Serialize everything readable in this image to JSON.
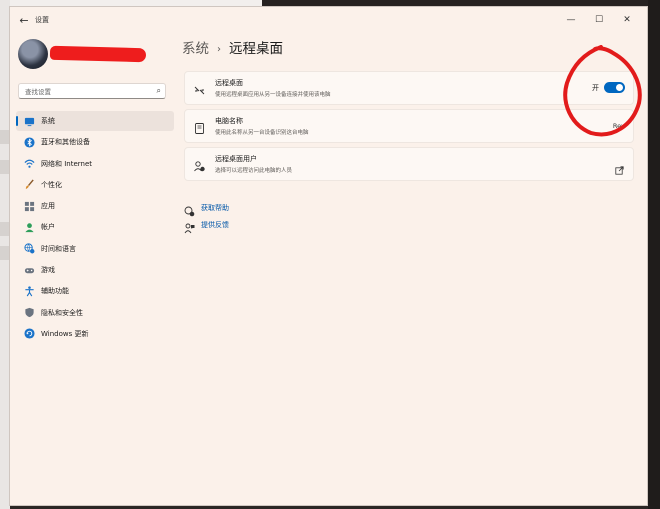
{
  "window": {
    "title": "设置",
    "controls": {
      "minimize": "—",
      "maximize": "☐",
      "close": "✕"
    }
  },
  "sidebar": {
    "search_placeholder": "查找设置",
    "items": [
      {
        "label": "系统",
        "icon": "monitor-icon",
        "selected": true
      },
      {
        "label": "蓝牙和其他设备",
        "icon": "bluetooth-icon",
        "selected": false
      },
      {
        "label": "网络和 Internet",
        "icon": "wifi-icon",
        "selected": false
      },
      {
        "label": "个性化",
        "icon": "paintbrush-icon",
        "selected": false
      },
      {
        "label": "应用",
        "icon": "apps-icon",
        "selected": false
      },
      {
        "label": "帐户",
        "icon": "account-icon",
        "selected": false
      },
      {
        "label": "时间和语言",
        "icon": "globe-clock-icon",
        "selected": false
      },
      {
        "label": "游戏",
        "icon": "gamepad-icon",
        "selected": false
      },
      {
        "label": "辅助功能",
        "icon": "accessibility-icon",
        "selected": false
      },
      {
        "label": "隐私和安全性",
        "icon": "shield-icon",
        "selected": false
      },
      {
        "label": "Windows 更新",
        "icon": "update-icon",
        "selected": false
      }
    ]
  },
  "header": {
    "parent": "系统",
    "separator": "›",
    "current": "远程桌面"
  },
  "cards": {
    "remote_desktop": {
      "title": "远程桌面",
      "subtitle": "使用远程桌面应用从另一设备连接并使用该电脑",
      "toggle_label": "开",
      "toggle_on": true
    },
    "pc_name": {
      "title": "电脑名称",
      "subtitle": "使用此名称从另一台设备识别这台电脑",
      "value": "Rey"
    },
    "users": {
      "title": "远程桌面用户",
      "subtitle": "选择可以远程访问此电脑的人员"
    }
  },
  "links": {
    "help": "获取帮助",
    "feedback": "提供反馈"
  },
  "colors": {
    "accent": "#0067c0",
    "window_bg": "#fbf1ea",
    "annotation": "#e21b1b"
  }
}
